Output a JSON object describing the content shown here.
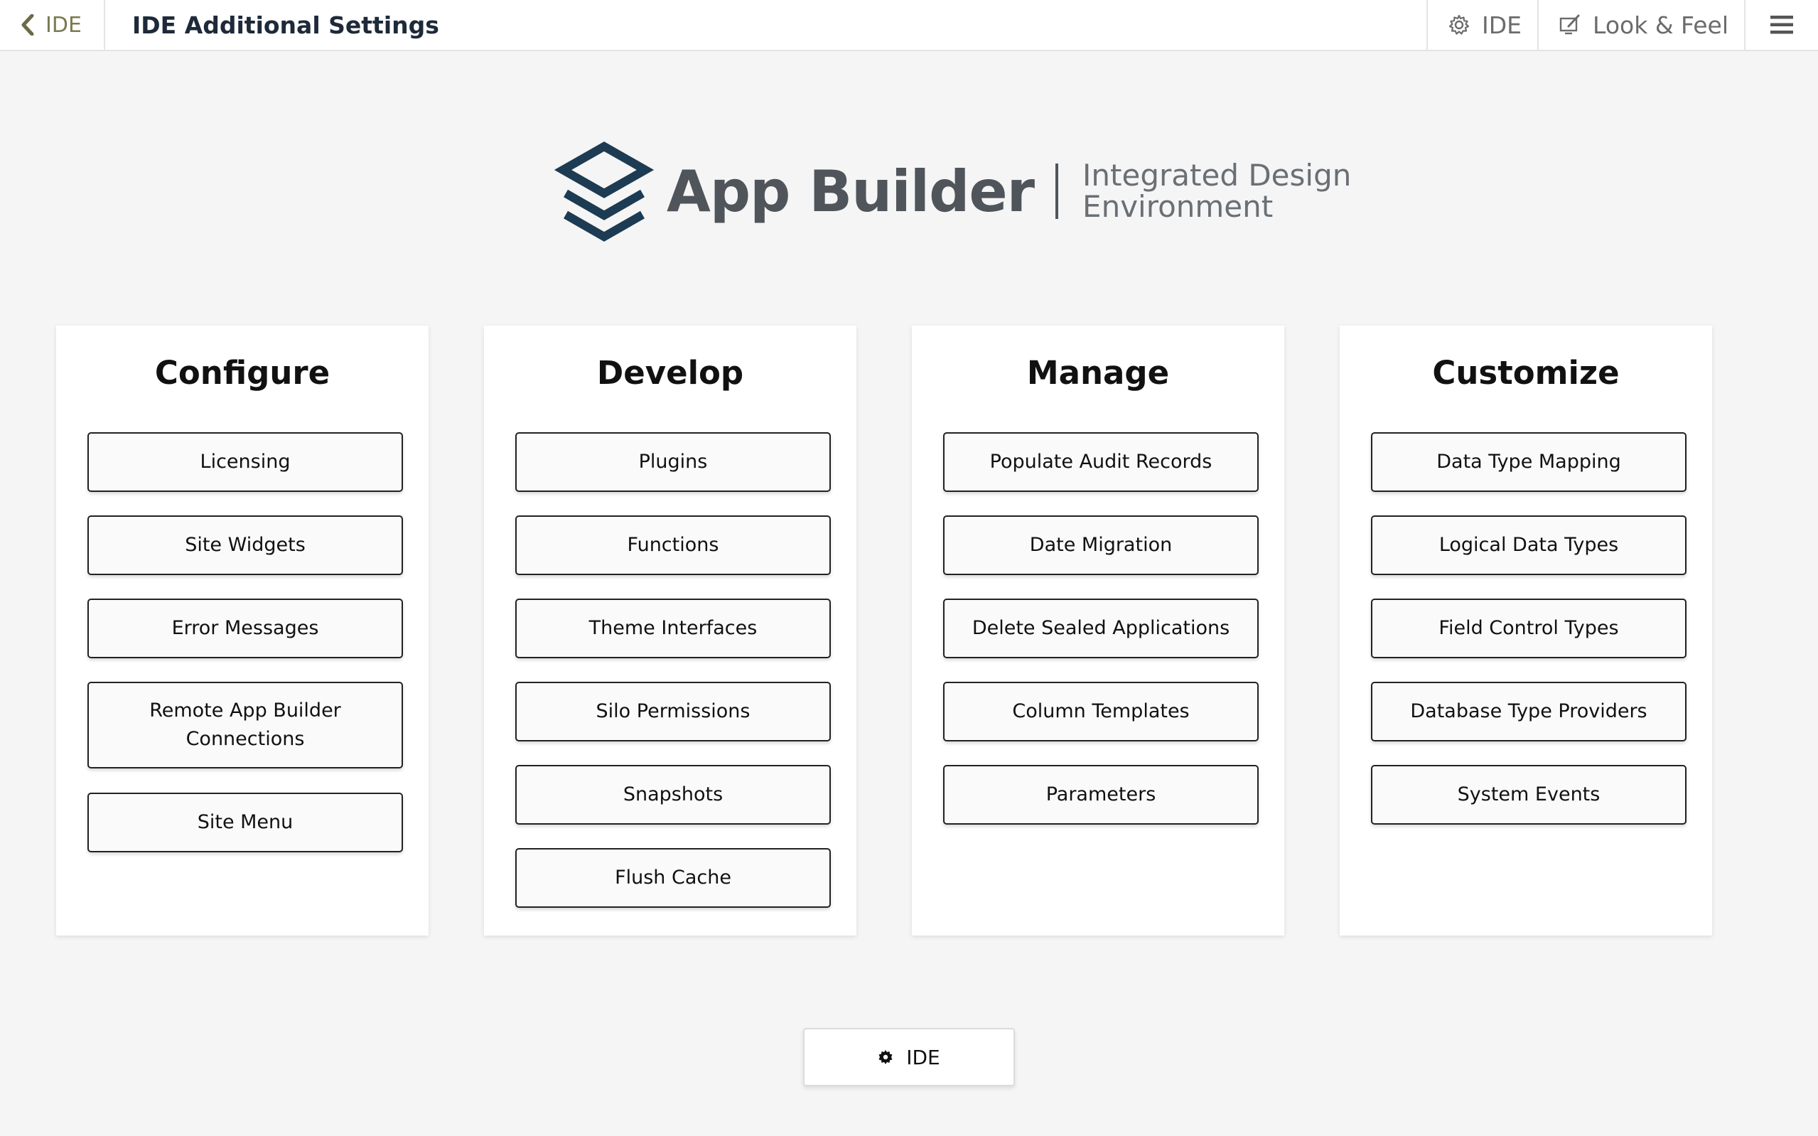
{
  "header": {
    "back_label": "IDE",
    "title": "IDE Additional Settings",
    "actions": [
      {
        "icon": "gear-icon",
        "label": "IDE"
      },
      {
        "icon": "look-feel-icon",
        "label": "Look & Feel"
      }
    ],
    "menu_icon": "hamburger-menu-icon"
  },
  "logo": {
    "name": "App Builder",
    "tagline_line1": "Integrated Design",
    "tagline_line2": "Environment",
    "brand_color": "#1d3b52"
  },
  "panels": [
    {
      "title": "Configure",
      "buttons": [
        "Licensing",
        "Site Widgets",
        "Error Messages",
        "Remote App Builder Connections",
        "Site Menu"
      ]
    },
    {
      "title": "Develop",
      "buttons": [
        "Plugins",
        "Functions",
        "Theme Interfaces",
        "Silo Permissions",
        "Snapshots",
        "Flush Cache"
      ]
    },
    {
      "title": "Manage",
      "buttons": [
        "Populate Audit Records",
        "Date Migration",
        "Delete Sealed Applications",
        "Column Templates",
        "Parameters"
      ]
    },
    {
      "title": "Customize",
      "buttons": [
        "Data Type Mapping",
        "Logical Data Types",
        "Field Control Types",
        "Database Type Providers",
        "System Events"
      ]
    }
  ],
  "footer_button": {
    "icon": "gear-icon",
    "label": "IDE"
  }
}
